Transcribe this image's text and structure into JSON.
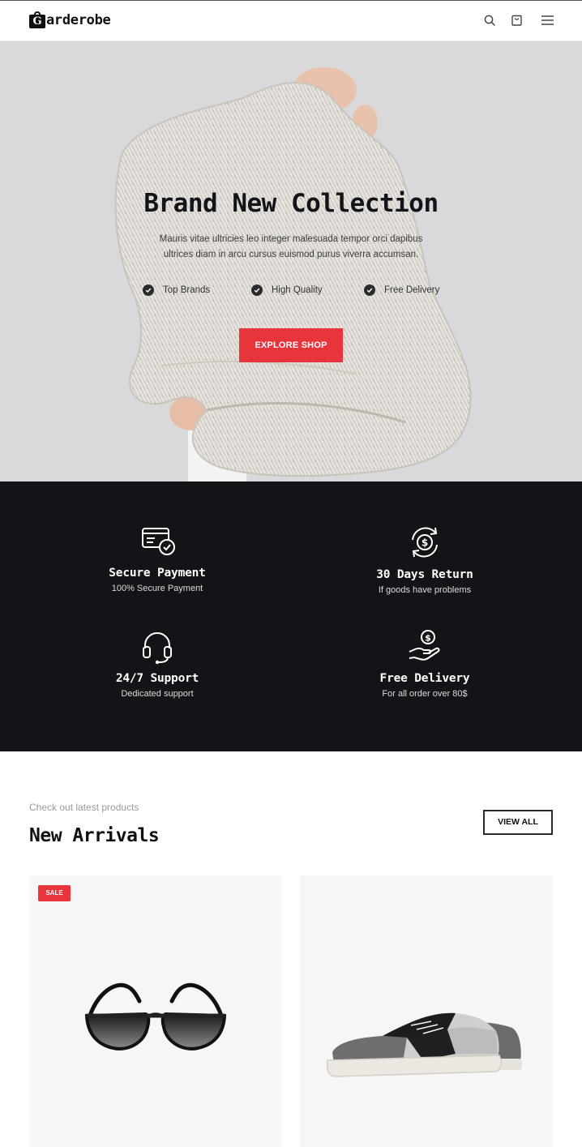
{
  "header": {
    "logo_letter": "G",
    "logo_text": "arderobe",
    "icons": [
      "search-icon",
      "bag-icon",
      "menu-icon"
    ]
  },
  "hero": {
    "title": "Brand New Collection",
    "subtitle": "Mauris vitae ultricies leo integer malesuada tempor orci dapibus ultrices diam in arcu cursus euismod purus viverra accumsan.",
    "features": [
      "Top Brands",
      "High Quality",
      "Free Delivery"
    ],
    "cta_label": "EXPLORE SHOP"
  },
  "services": [
    {
      "icon": "secure-card-icon",
      "title": "Secure Payment",
      "desc": "100% Secure Payment"
    },
    {
      "icon": "money-return-icon",
      "title": "30 Days Return",
      "desc": "If goods have problems"
    },
    {
      "icon": "headset-icon",
      "title": "24/7 Support",
      "desc": "Dedicated support"
    },
    {
      "icon": "hand-coin-icon",
      "title": "Free Delivery",
      "desc": "For all order over 80$"
    }
  ],
  "arrivals": {
    "kicker": "Check out latest products",
    "title": "New Arrivals",
    "view_all_label": "VIEW ALL",
    "products": [
      {
        "badge": "SALE",
        "image": "sunglasses"
      },
      {
        "badge": "",
        "image": "sneaker"
      }
    ]
  },
  "colors": {
    "accent": "#e8343b",
    "dark_band": "#151318",
    "hero_bg": "#d9d9db",
    "card_bg": "#f6f6f6"
  }
}
